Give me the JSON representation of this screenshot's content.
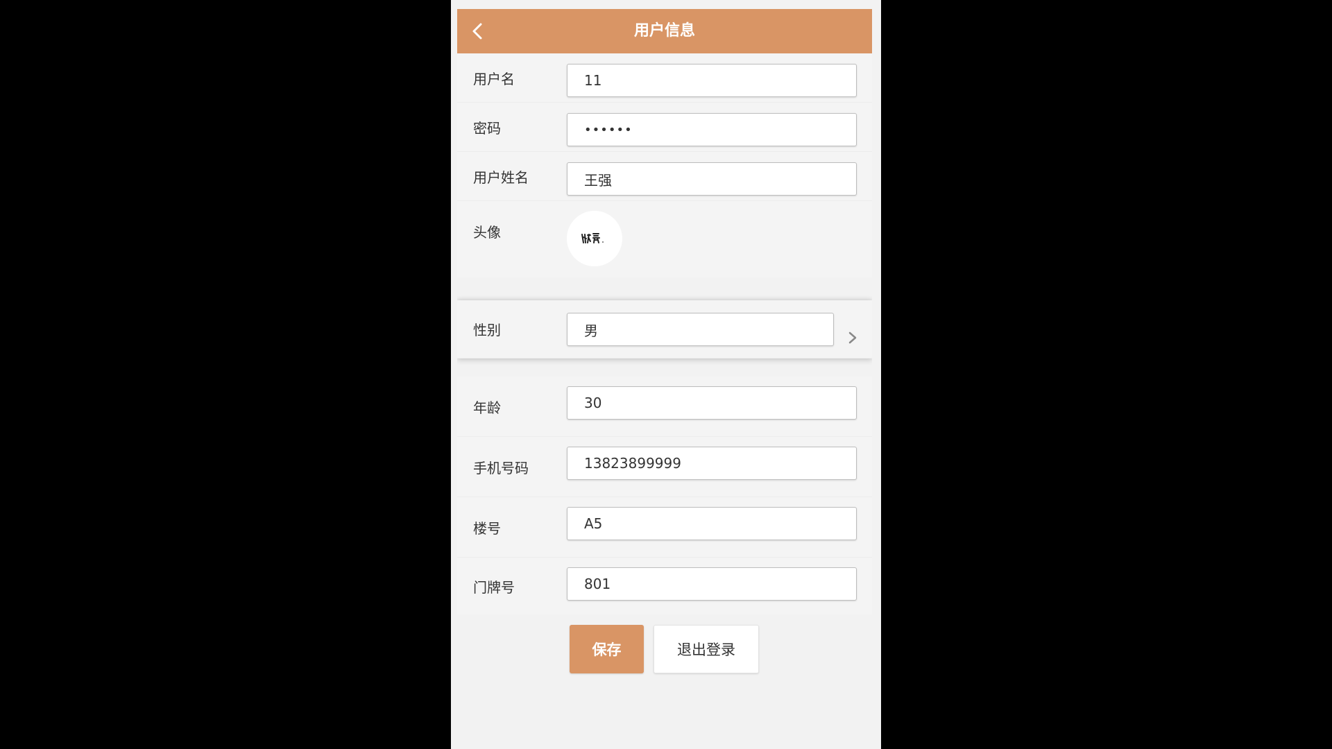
{
  "header": {
    "title": "用户信息",
    "back_icon": "chevron-left-icon",
    "background": "#d99565"
  },
  "form": {
    "username": {
      "label": "用户名",
      "value": "11"
    },
    "password": {
      "label": "密码",
      "value": "••••••"
    },
    "real_name": {
      "label": "用户姓名",
      "value": "王强"
    },
    "avatar": {
      "label": "头像",
      "icon": "avatar-image"
    },
    "gender": {
      "label": "性别",
      "value": "男",
      "icon": "chevron-right-icon"
    },
    "age": {
      "label": "年龄",
      "value": "30"
    },
    "phone": {
      "label": "手机号码",
      "value": "13823899999"
    },
    "building": {
      "label": "楼号",
      "value": "A5"
    },
    "door_number": {
      "label": "门牌号",
      "value": "801"
    }
  },
  "actions": {
    "save_label": "保存",
    "logout_label": "退出登录"
  },
  "colors": {
    "accent": "#d99565",
    "page_background": "#f2f2f2",
    "outer_background": "#000000"
  }
}
